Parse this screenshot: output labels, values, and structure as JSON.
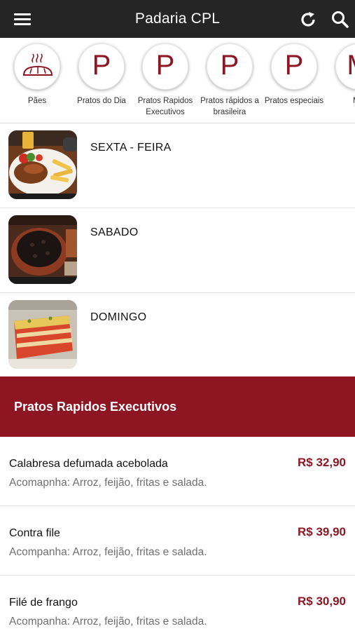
{
  "header": {
    "title": "Padaria CPL",
    "menu_icon": "hamburger-menu-icon",
    "refresh_icon": "refresh-icon",
    "search_icon": "search-icon",
    "background": "#252525"
  },
  "categories": [
    {
      "label": "Pães",
      "icon": "bread-icon",
      "letter": ""
    },
    {
      "label": "Pratos do Dia",
      "icon": "letter-avatar",
      "letter": "P"
    },
    {
      "label": "Pratos Rapidos Executivos",
      "icon": "letter-avatar",
      "letter": "P"
    },
    {
      "label": "Pratos rápidos a brasileira",
      "icon": "letter-avatar",
      "letter": "P"
    },
    {
      "label": "Pratos especiais",
      "icon": "letter-avatar",
      "letter": "P"
    },
    {
      "label": "Ma",
      "icon": "letter-avatar",
      "letter": "M"
    }
  ],
  "days": [
    {
      "label": "SEXTA - FEIRA",
      "image": "steak-plate-photo"
    },
    {
      "label": "SABADO",
      "image": "feijoada-pot-photo"
    },
    {
      "label": "DOMINGO",
      "image": "lasagna-photo"
    }
  ],
  "section": {
    "title": "Pratos Rapidos Executivos",
    "color": "#8e1623"
  },
  "dishes": [
    {
      "name": "Calabresa defumada acebolada",
      "description": "Acomapnha: Arroz, feijão, fritas e salada.",
      "price": "R$ 32,90"
    },
    {
      "name": "Contra file",
      "description": "Acompanha: Arroz, feijão, fritas e salada.",
      "price": "R$ 39,90"
    },
    {
      "name": "Filé de frango",
      "description": "Acompanha: Arroz, feijão, fritas e salada.",
      "price": "R$ 30,90"
    }
  ],
  "accent": "#8e1623"
}
